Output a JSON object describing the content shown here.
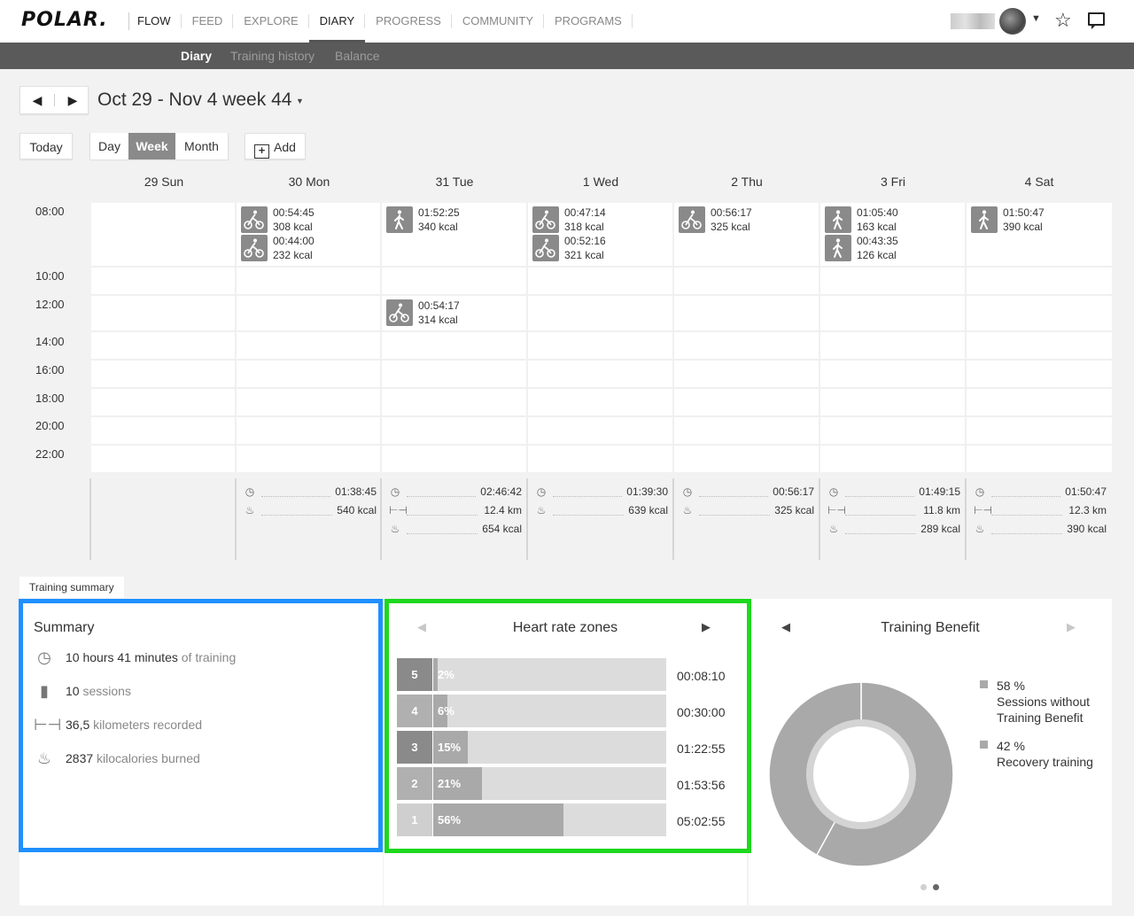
{
  "header": {
    "logo": "POLAR.",
    "nav": [
      {
        "label": "FLOW"
      },
      {
        "label": "FEED"
      },
      {
        "label": "EXPLORE"
      },
      {
        "label": "DIARY"
      },
      {
        "label": "PROGRESS"
      },
      {
        "label": "COMMUNITY"
      },
      {
        "label": "PROGRAMS"
      }
    ],
    "icons": {
      "user_menu": "chevron-down-icon",
      "favorites": "star-icon",
      "messages": "message-icon"
    }
  },
  "subnav": [
    {
      "label": "Diary"
    },
    {
      "label": "Training history"
    },
    {
      "label": "Balance"
    }
  ],
  "toolbar": {
    "prev": "◀",
    "next": "▶",
    "week_title": "Oct 29 - Nov 4 week 44",
    "today": "Today",
    "views": [
      {
        "label": "Day"
      },
      {
        "label": "Week"
      },
      {
        "label": "Month"
      }
    ],
    "active_view": "Week",
    "add": "Add"
  },
  "calendar": {
    "days": [
      "29 Sun",
      "30 Mon",
      "31 Tue",
      "1 Wed",
      "2 Thu",
      "3 Fri",
      "4 Sat"
    ],
    "times": [
      "08:00",
      "10:00",
      "12:00",
      "14:00",
      "16:00",
      "18:00",
      "20:00",
      "22:00"
    ],
    "sessions": [
      {
        "day": 1,
        "slot": "08:00",
        "duration": "00:54:45",
        "kcal": "308 kcal",
        "sport": "bike"
      },
      {
        "day": 1,
        "slot": "08:00",
        "duration": "00:44:00",
        "kcal": "232 kcal",
        "sport": "bike"
      },
      {
        "day": 2,
        "slot": "08:00",
        "duration": "01:52:25",
        "kcal": "340 kcal",
        "sport": "walk"
      },
      {
        "day": 2,
        "slot": "12:00",
        "duration": "00:54:17",
        "kcal": "314 kcal",
        "sport": "bike"
      },
      {
        "day": 3,
        "slot": "08:00",
        "duration": "00:47:14",
        "kcal": "318 kcal",
        "sport": "bike"
      },
      {
        "day": 3,
        "slot": "08:00",
        "duration": "00:52:16",
        "kcal": "321 kcal",
        "sport": "bike"
      },
      {
        "day": 4,
        "slot": "08:00",
        "duration": "00:56:17",
        "kcal": "325 kcal",
        "sport": "bike"
      },
      {
        "day": 5,
        "slot": "08:00",
        "duration": "01:05:40",
        "kcal": "163 kcal",
        "sport": "walk"
      },
      {
        "day": 5,
        "slot": "08:00",
        "duration": "00:43:35",
        "kcal": "126 kcal",
        "sport": "walk"
      },
      {
        "day": 6,
        "slot": "08:00",
        "duration": "01:50:47",
        "kcal": "390 kcal",
        "sport": "walk"
      }
    ],
    "totals": [
      {
        "day": 0,
        "rows": []
      },
      {
        "day": 1,
        "rows": [
          {
            "icon": "stopwatch-icon",
            "value": "01:38:45"
          },
          {
            "icon": "flame-icon",
            "value": "540 kcal"
          }
        ]
      },
      {
        "day": 2,
        "rows": [
          {
            "icon": "stopwatch-icon",
            "value": "02:46:42"
          },
          {
            "icon": "distance-icon",
            "value": "12.4 km"
          },
          {
            "icon": "flame-icon",
            "value": "654 kcal"
          }
        ]
      },
      {
        "day": 3,
        "rows": [
          {
            "icon": "stopwatch-icon",
            "value": "01:39:30"
          },
          {
            "icon": "flame-icon",
            "value": "639 kcal"
          }
        ]
      },
      {
        "day": 4,
        "rows": [
          {
            "icon": "stopwatch-icon",
            "value": "00:56:17"
          },
          {
            "icon": "flame-icon",
            "value": "325 kcal"
          }
        ]
      },
      {
        "day": 5,
        "rows": [
          {
            "icon": "stopwatch-icon",
            "value": "01:49:15"
          },
          {
            "icon": "distance-icon",
            "value": "11.8 km"
          },
          {
            "icon": "flame-icon",
            "value": "289 kcal"
          }
        ]
      },
      {
        "day": 6,
        "rows": [
          {
            "icon": "stopwatch-icon",
            "value": "01:50:47"
          },
          {
            "icon": "distance-icon",
            "value": "12.3 km"
          },
          {
            "icon": "flame-icon",
            "value": "390 kcal"
          }
        ]
      }
    ]
  },
  "training_summary": {
    "tab": "Training summary",
    "summary": {
      "title": "Summary",
      "rows": [
        {
          "icon": "stopwatch-icon",
          "value": "10 hours 41 minutes",
          "label": "of training"
        },
        {
          "icon": "bar-chart-icon",
          "value": "10",
          "label": "sessions"
        },
        {
          "icon": "distance-icon",
          "value": "36,5",
          "label": "kilometers recorded"
        },
        {
          "icon": "flame-icon",
          "value": "2837",
          "label": "kilocalories burned"
        }
      ]
    },
    "heart_rate_zones": {
      "title": "Heart rate zones",
      "zones": [
        {
          "zone": "5",
          "pct": "2%",
          "fraction": 0.02,
          "time": "00:08:10",
          "color": "#8a8a8a"
        },
        {
          "zone": "4",
          "pct": "6%",
          "fraction": 0.06,
          "time": "00:30:00",
          "color": "#b0b0b0"
        },
        {
          "zone": "3",
          "pct": "15%",
          "fraction": 0.15,
          "time": "01:22:55",
          "color": "#8a8a8a"
        },
        {
          "zone": "2",
          "pct": "21%",
          "fraction": 0.21,
          "time": "01:53:56",
          "color": "#b0b0b0"
        },
        {
          "zone": "1",
          "pct": "56%",
          "fraction": 0.56,
          "time": "05:02:55",
          "color": "#cfcfcf"
        }
      ]
    },
    "training_benefit": {
      "title": "Training Benefit",
      "segments": [
        {
          "pct": "58 %",
          "fraction": 0.58,
          "label": "Sessions without Training Benefit",
          "color": "#a9a9a9"
        },
        {
          "pct": "42 %",
          "fraction": 0.42,
          "label": "Recovery training",
          "color": "#a9a9a9"
        }
      ],
      "page": 2,
      "pages": 2
    },
    "highlight_colors": {
      "summary": "#1e90ff",
      "heart_rate_zones": "#1ed81e"
    }
  }
}
